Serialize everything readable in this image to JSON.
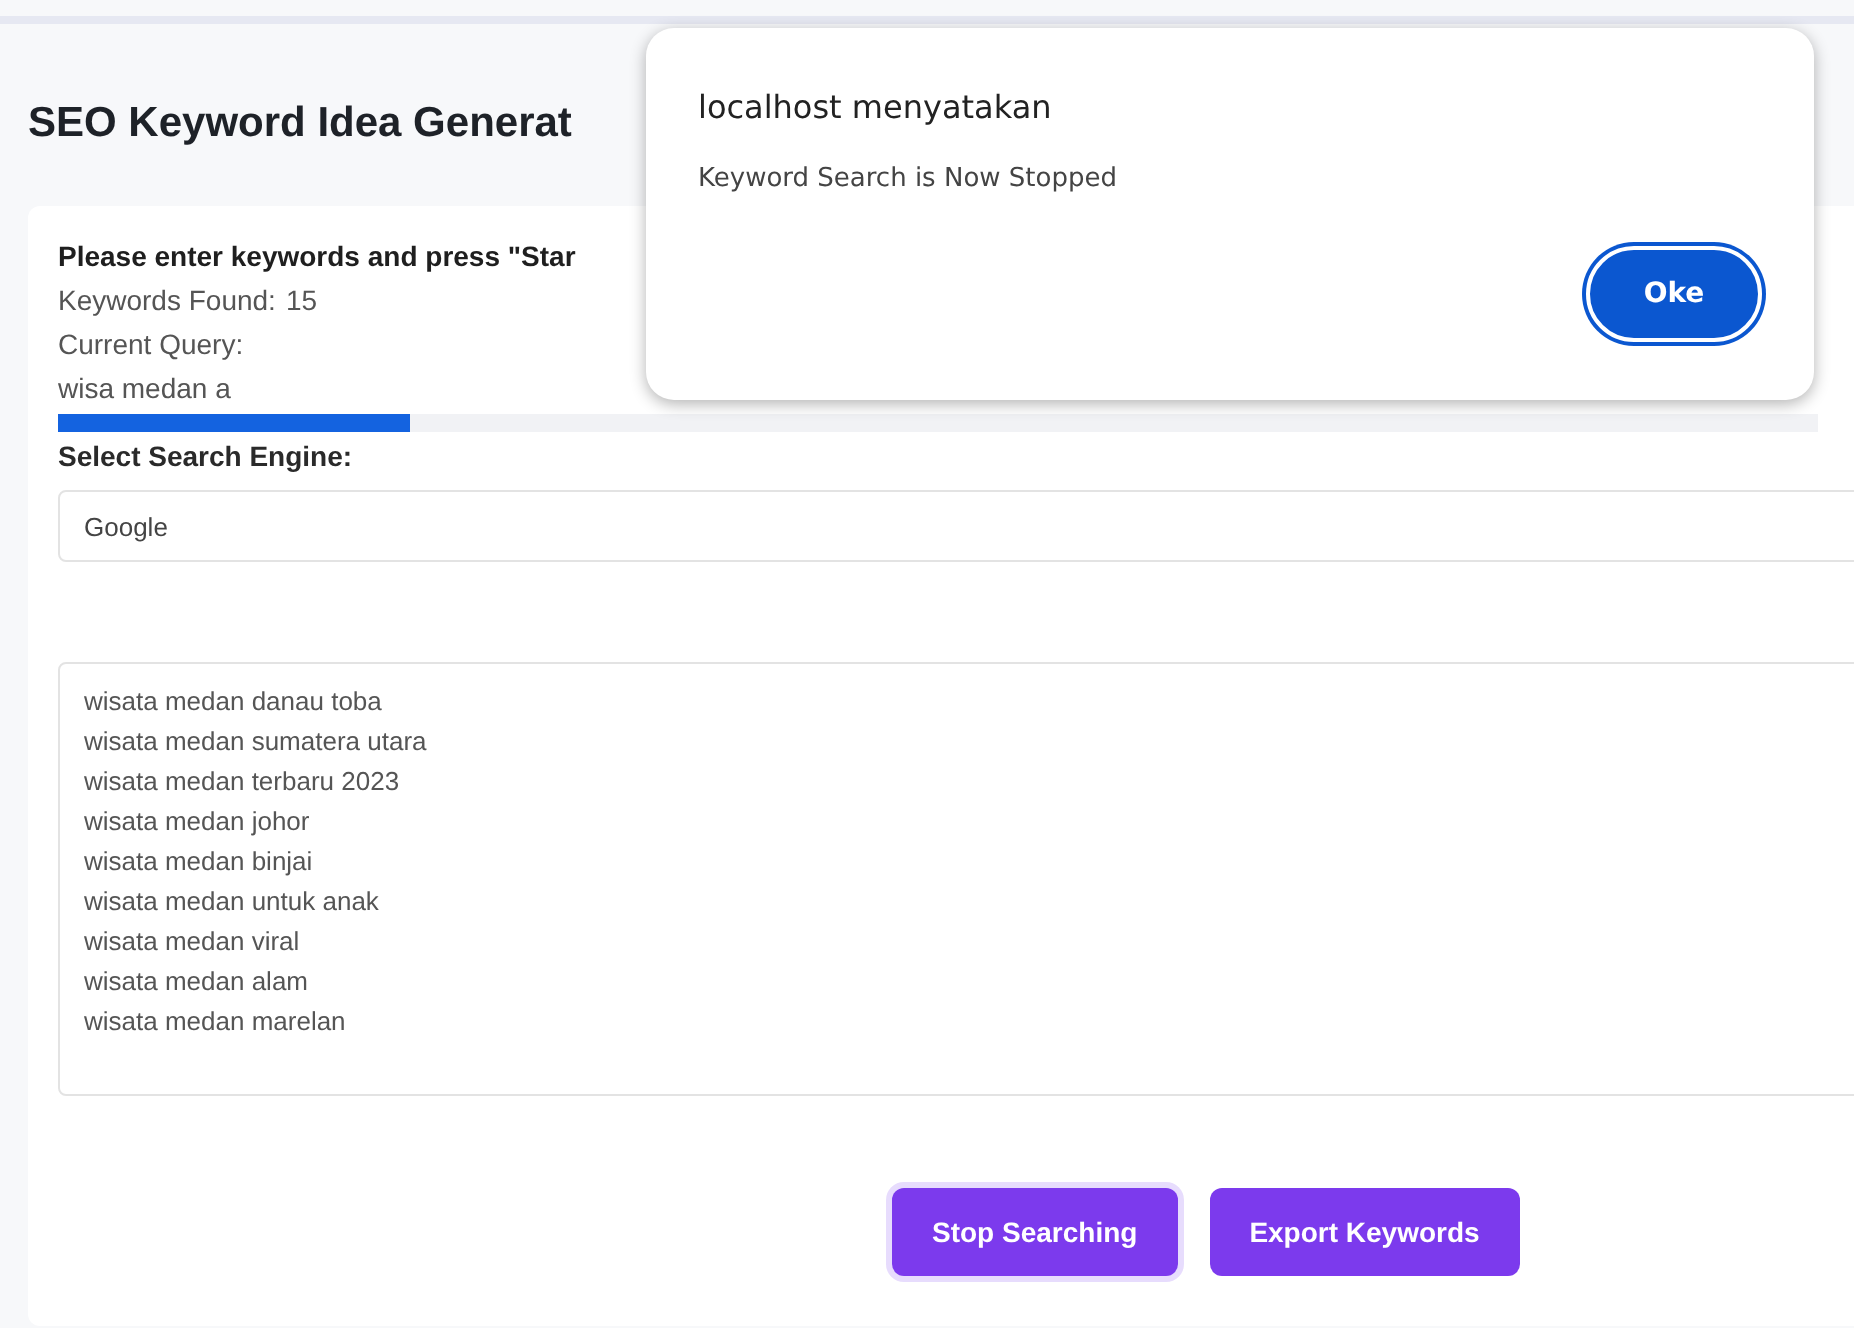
{
  "page_title": "SEO Keyword Idea Generat",
  "card": {
    "instruction": "Please enter keywords and press \"Star",
    "keywords_found_label": "Keywords Found:",
    "keywords_found": "15",
    "current_query_label": "Current Query:",
    "current_query": "wisa medan a",
    "progress": {
      "level": 0.2
    },
    "engine_label": "Select Search Engine:",
    "engine": "Google",
    "results": [
      "wisata medan danau toba",
      "wisata medan sumatera utara",
      "wisata medan terbaru 2023",
      "wisata medan johor",
      "wisata medan binjai",
      "wisata medan untuk anak",
      "wisata medan viral",
      "wisata medan alam",
      "wisata medan marelan"
    ],
    "buttons": [
      "Stop Searching",
      "Export Keywords"
    ]
  },
  "dialog": {
    "title": "localhost menyatakan",
    "message": "Keyword Search is Now Stopped",
    "button": "Oke"
  }
}
